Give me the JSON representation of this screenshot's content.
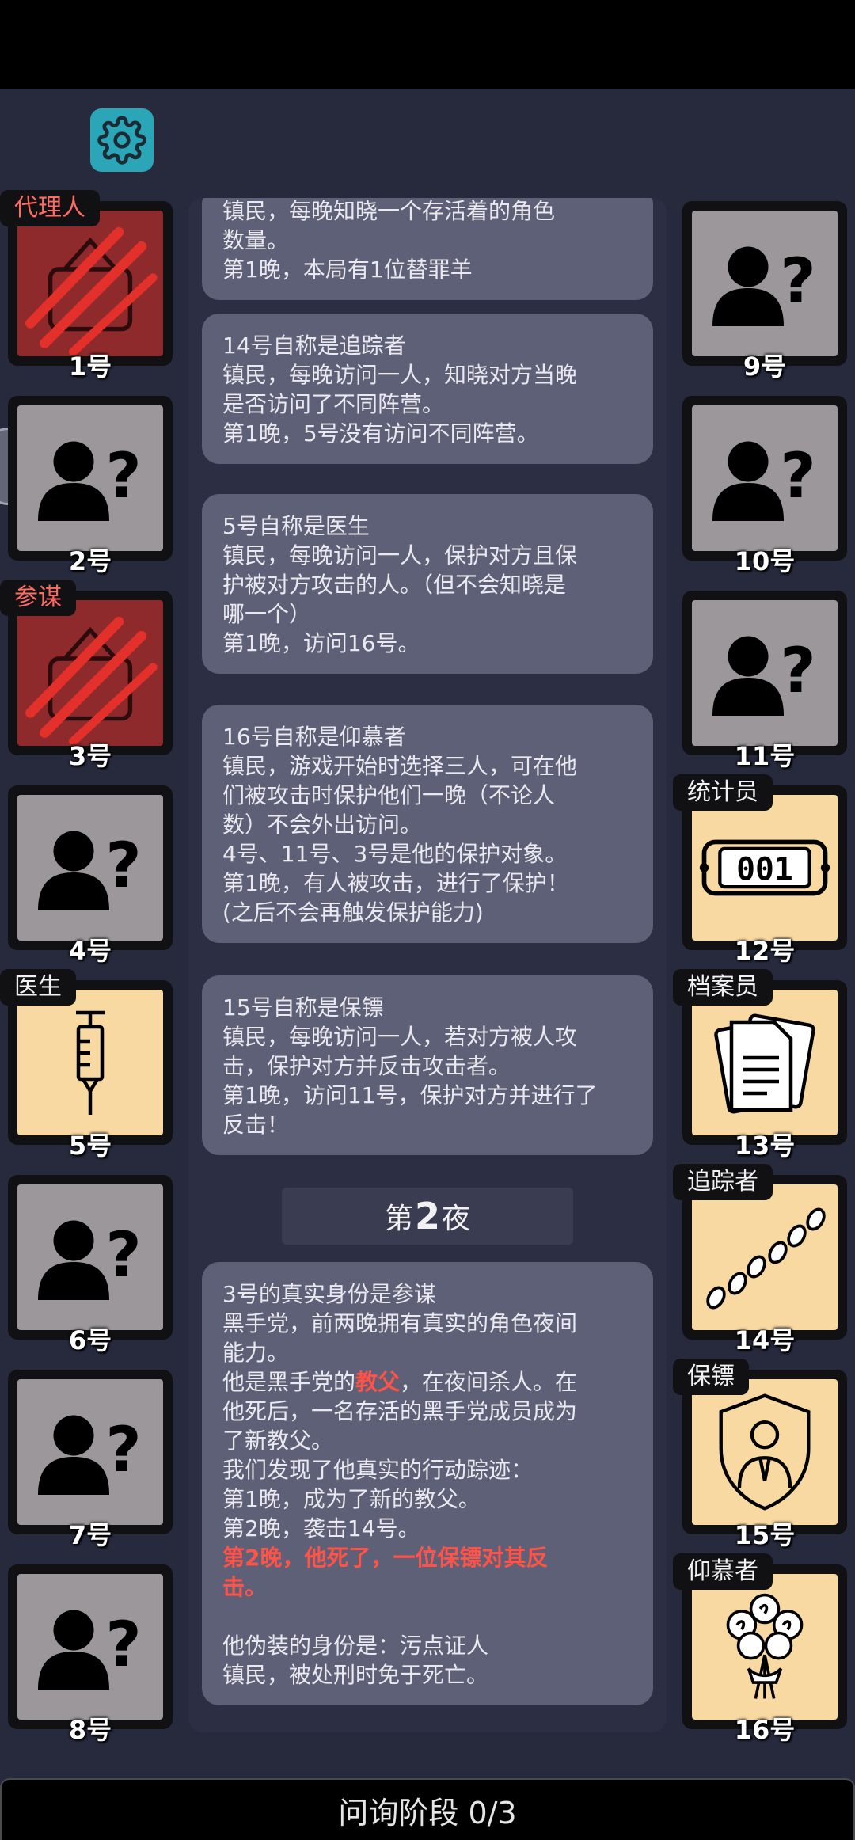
{
  "settings_icon": "gear-icon",
  "players_left": [
    {
      "num": "1号",
      "role": "代理人",
      "tag_color": "red",
      "state": "slain"
    },
    {
      "num": "2号",
      "role": "",
      "state": "unknown"
    },
    {
      "num": "3号",
      "role": "参谋",
      "tag_color": "red",
      "state": "slain"
    },
    {
      "num": "4号",
      "role": "",
      "state": "unknown"
    },
    {
      "num": "5号",
      "role": "医生",
      "tag_color": "white",
      "state": "town",
      "icon": "syringe-icon"
    },
    {
      "num": "6号",
      "role": "",
      "state": "unknown"
    },
    {
      "num": "7号",
      "role": "",
      "state": "unknown"
    },
    {
      "num": "8号",
      "role": "",
      "state": "unknown"
    }
  ],
  "players_right": [
    {
      "num": "9号",
      "role": "",
      "state": "unknown"
    },
    {
      "num": "10号",
      "role": "",
      "state": "unknown"
    },
    {
      "num": "11号",
      "role": "",
      "state": "unknown"
    },
    {
      "num": "12号",
      "role": "统计员",
      "tag_color": "white",
      "state": "town",
      "icon": "counter-icon",
      "counter_text": "001"
    },
    {
      "num": "13号",
      "role": "档案员",
      "tag_color": "white",
      "state": "town",
      "icon": "documents-icon"
    },
    {
      "num": "14号",
      "role": "追踪者",
      "tag_color": "white",
      "state": "town",
      "icon": "footprints-icon"
    },
    {
      "num": "15号",
      "role": "保镖",
      "tag_color": "white",
      "state": "town",
      "icon": "shield-person-icon"
    },
    {
      "num": "16号",
      "role": "仰慕者",
      "tag_color": "white",
      "state": "town",
      "icon": "bouquet-icon"
    }
  ],
  "feed": {
    "card0": {
      "lines": [
        "镇民，每晚知晓一个存活着的角色",
        "数量。",
        "第1晚，本局有1位替罪羊"
      ]
    },
    "card1": {
      "lines": [
        "14号自称是追踪者",
        "镇民，每晚访问一人，知晓对方当晚",
        "是否访问了不同阵营。",
        "第1晚，5号没有访问不同阵营。"
      ]
    },
    "card2": {
      "lines": [
        "5号自称是医生",
        "镇民，每晚访问一人，保护对方且保",
        "护被对方攻击的人。（但不会知晓是",
        "哪一个）",
        "第1晚，访问16号。"
      ]
    },
    "card3": {
      "lines": [
        "16号自称是仰慕者",
        "镇民，游戏开始时选择三人，可在他",
        "们被攻击时保护他们一晚（不论人",
        "数）不会外出访问。",
        "4号、11号、3号是他的保护对象。",
        "第1晚，有人被攻击，进行了保护！",
        "(之后不会再触发保护能力)"
      ]
    },
    "card4": {
      "lines": [
        "15号自称是保镖",
        "镇民，每晚访问一人，若对方被人攻",
        "击，保护对方并反击攻击者。",
        "第1晚，访问11号，保护对方并进行了",
        "反击！"
      ]
    },
    "night": {
      "prefix": "第",
      "number": "2",
      "suffix": "夜"
    },
    "card5": {
      "line1": "3号的真实身份是参谋",
      "line2": "黑手党，前两晚拥有真实的角色夜间",
      "line3": "能力。",
      "line4_pre": "他是黑手党的",
      "line4_hl": "教父",
      "line4_post": "，在夜间杀人。在",
      "line5": "他死后，一名存活的黑手党成员成为",
      "line6": "了新教父。",
      "line7": "我们发现了他真实的行动踪迹：",
      "line8": "第1晚，成为了新的教父。",
      "line9": "第2晚，袭击14号。",
      "line10": "第2晚，他死了，一位保镖对其反",
      "line11": "击。",
      "line12": "他伪装的身份是：污点证人",
      "line13": "镇民，被处刑时免于死亡。"
    }
  },
  "phase": {
    "label": "问询阶段 0/3"
  },
  "colors": {
    "background": "#272a3d",
    "card": "#5e6077",
    "highlight": "#ff5348",
    "town_tile": "#f9d9a2",
    "slain_tile": "#8e2a2b",
    "unknown_tile": "#9b979a"
  }
}
